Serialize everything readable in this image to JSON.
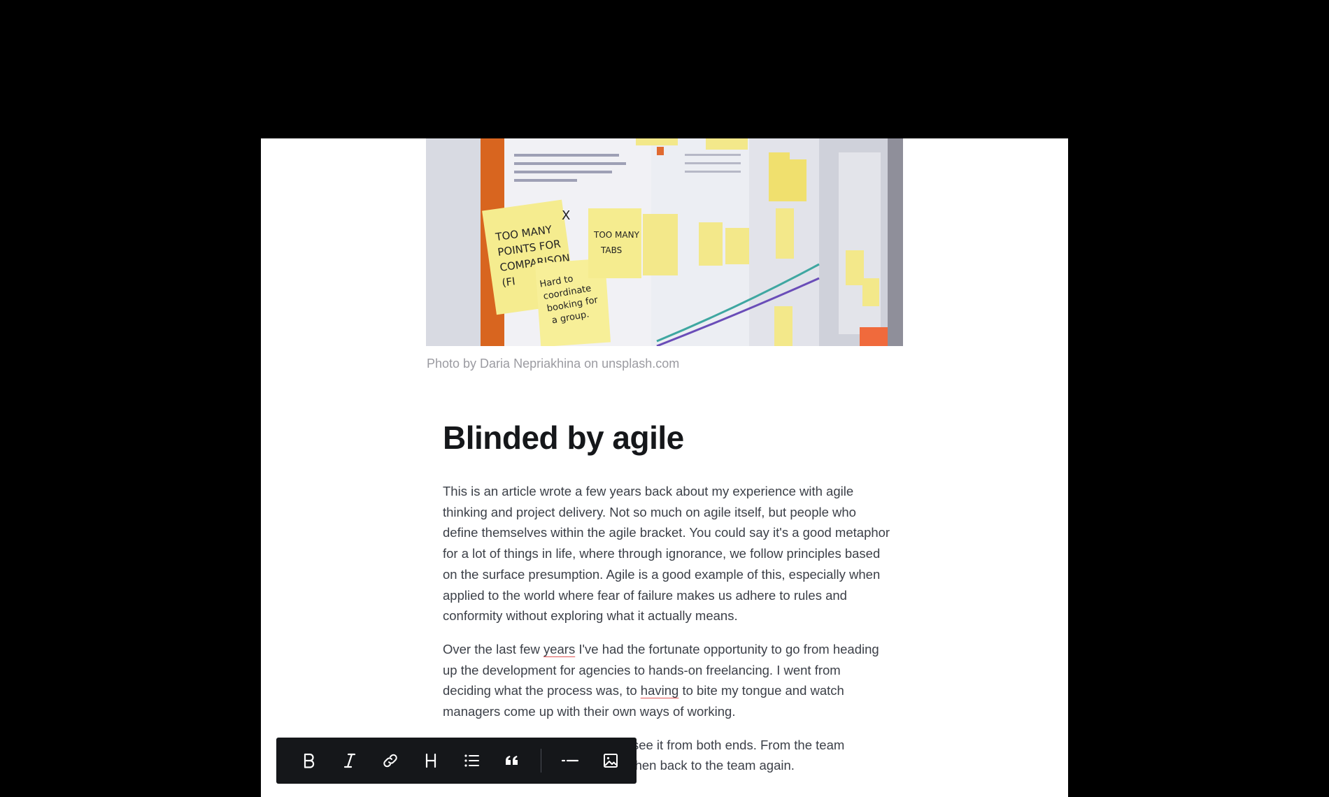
{
  "photo": {
    "alt": "Sticky notes on a whiteboard",
    "notes": {
      "note1": "TOO MANY POINTS FOR COMPARISON (FI",
      "note2": "Hard to coordinate booking for a group.",
      "note3": "TOO MANY TABS"
    },
    "caption_prefix": "Photo by Daria Nepriakhina on ",
    "caption_link": "unsplash.com"
  },
  "article": {
    "title": "Blinded by agile",
    "paragraph1": "This is an article wrote a few years back about my experience with agile thinking and project delivery. Not so much on agile itself, but people who define themselves within the agile bracket. You could say it's a good metaphor for a lot of things in life, where through ignorance, we follow principles based on the surface presumption. Agile is a good example of this, especially when applied to the world where fear of failure makes us adhere to rules and conformity without exploring what it actually means.",
    "paragraph2": {
      "part1": "Over the last few ",
      "word1": "years",
      "part2": " I've had the fortunate opportunity to go from heading up the development for agencies to hands-on freelancing. I went from deciding what the process was, to ",
      "word2": "having",
      "part3": " to bite my tongue and watch managers come up with their own ways of working."
    },
    "paragraph3": "It's been an eye-opener to get to see it from both ends. From the team perspective to the manager, and then back to the team again."
  },
  "toolbar": {
    "buttons": [
      {
        "name": "bold-button",
        "icon": "bold-icon",
        "label": "B"
      },
      {
        "name": "italic-button",
        "icon": "italic-icon",
        "label": "I"
      },
      {
        "name": "link-button",
        "icon": "link-icon"
      },
      {
        "name": "heading-button",
        "icon": "heading-icon",
        "label": "H"
      },
      {
        "name": "list-button",
        "icon": "bullet-list-icon"
      },
      {
        "name": "quote-button",
        "icon": "quote-icon"
      },
      {
        "name": "divider-button",
        "icon": "horizontal-rule-icon"
      },
      {
        "name": "image-button",
        "icon": "image-icon"
      }
    ]
  },
  "colors": {
    "background": "#000000",
    "sheet": "#ffffff",
    "title": "#15171a",
    "body_text": "#3c4048",
    "caption": "#9b9ba1",
    "toolbar": "#15171a",
    "spellcheck_underline": "#e25555",
    "sticky_note": "#f5ec8f"
  }
}
